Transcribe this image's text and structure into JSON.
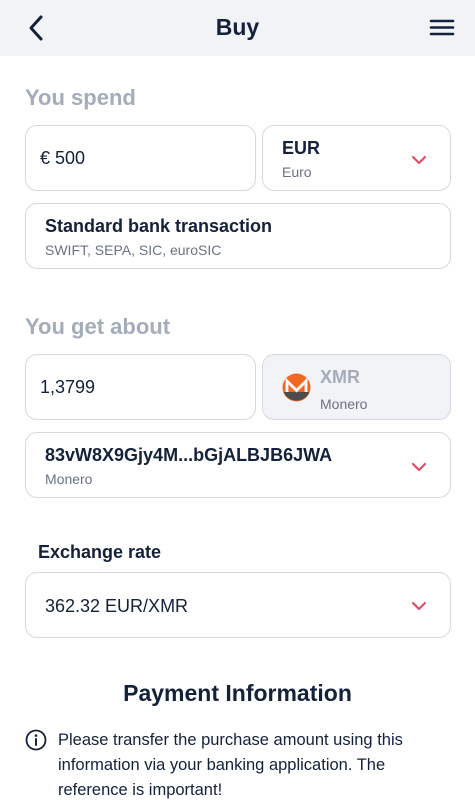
{
  "header": {
    "title": "Buy"
  },
  "spend": {
    "section_label": "You spend",
    "amount_value": "€ 500",
    "currency_code": "EUR",
    "currency_name": "Euro",
    "method_title": "Standard bank transaction",
    "method_subtitle": "SWIFT, SEPA, SIC, euroSIC"
  },
  "receive": {
    "section_label": "You get about",
    "amount_value": "1,3799",
    "currency_code": "XMR",
    "currency_name": "Monero",
    "wallet_address": "83vW8X9Gjy4M...bGjALBJB6JWA",
    "wallet_network": "Monero"
  },
  "exchange": {
    "label": "Exchange rate",
    "value": "362.32 EUR/XMR"
  },
  "payment": {
    "title": "Payment Information",
    "info_text": "Please transfer the purchase amount using this information via your banking application. The reference is important!"
  },
  "colors": {
    "accent_chevron": "#e0506b",
    "monero_orange": "#f26822",
    "header_bg": "#f2f3f6",
    "muted_label": "#a4acbb"
  }
}
